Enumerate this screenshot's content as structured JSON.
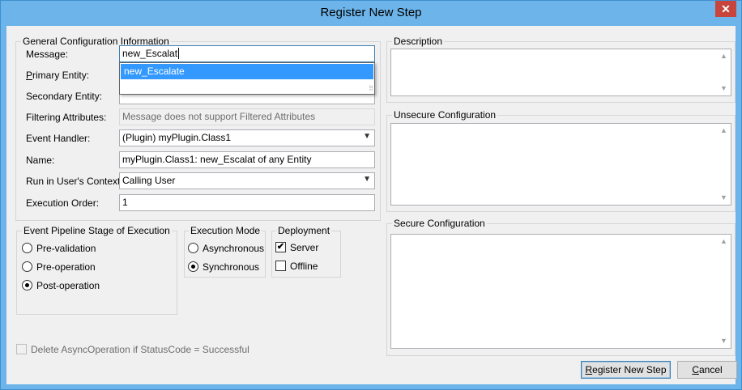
{
  "window": {
    "title": "Register New Step",
    "close_glyph": "✕"
  },
  "general": {
    "group_title": "General Configuration Information",
    "message_label": "Message:",
    "message_value": "new_Escalat",
    "message_suggestion": "new_Escalate",
    "primary_entity_label_underlined": "P",
    "primary_entity_label_rest": "rimary Entity:",
    "secondary_entity_label": "Secondary Entity:",
    "filtering_label": "Filtering Attributes:",
    "filtering_value": "Message does not support Filtered Attributes",
    "event_handler_label": "Event Handler:",
    "event_handler_value": "(Plugin) myPlugin.Class1",
    "name_label": "Name:",
    "name_value": "myPlugin.Class1: new_Escalat of  any Entity",
    "run_context_label": "Run in User's Context:",
    "run_context_value": "Calling User",
    "execution_order_label": "Execution Order:",
    "execution_order_value": "1"
  },
  "pipeline": {
    "group_title": "Event Pipeline Stage of Execution",
    "options": [
      "Pre-validation",
      "Pre-operation",
      "Post-operation"
    ],
    "selected": "Post-operation"
  },
  "execution_mode": {
    "group_title": "Execution Mode",
    "options": [
      "Asynchronous",
      "Synchronous"
    ],
    "selected": "Synchronous"
  },
  "deployment": {
    "group_title": "Deployment",
    "server_label": "Server",
    "server_checked": true,
    "offline_label": "Offline",
    "offline_checked": false
  },
  "delete_async": {
    "label": "Delete AsyncOperation if StatusCode = Successful",
    "checked": false,
    "enabled": false
  },
  "description": {
    "group_title": "Description"
  },
  "unsecure_config": {
    "group_title": "Unsecure Configuration"
  },
  "secure_config": {
    "group_title": "Secure Configuration"
  },
  "buttons": {
    "register_underlined": "R",
    "register_rest": "egister New Step",
    "cancel_underlined": "C",
    "cancel_rest": "ancel"
  },
  "icons": {
    "dropdown_arrow": "▼",
    "scroll_up": "▲",
    "scroll_down": "▼",
    "checkmark": "✔",
    "resize_grip": "⠿"
  },
  "colors": {
    "titlebar": "#6cb4ea",
    "close_button": "#c7453c",
    "selection": "#3399ff",
    "client_bg": "#f0f0f0"
  }
}
